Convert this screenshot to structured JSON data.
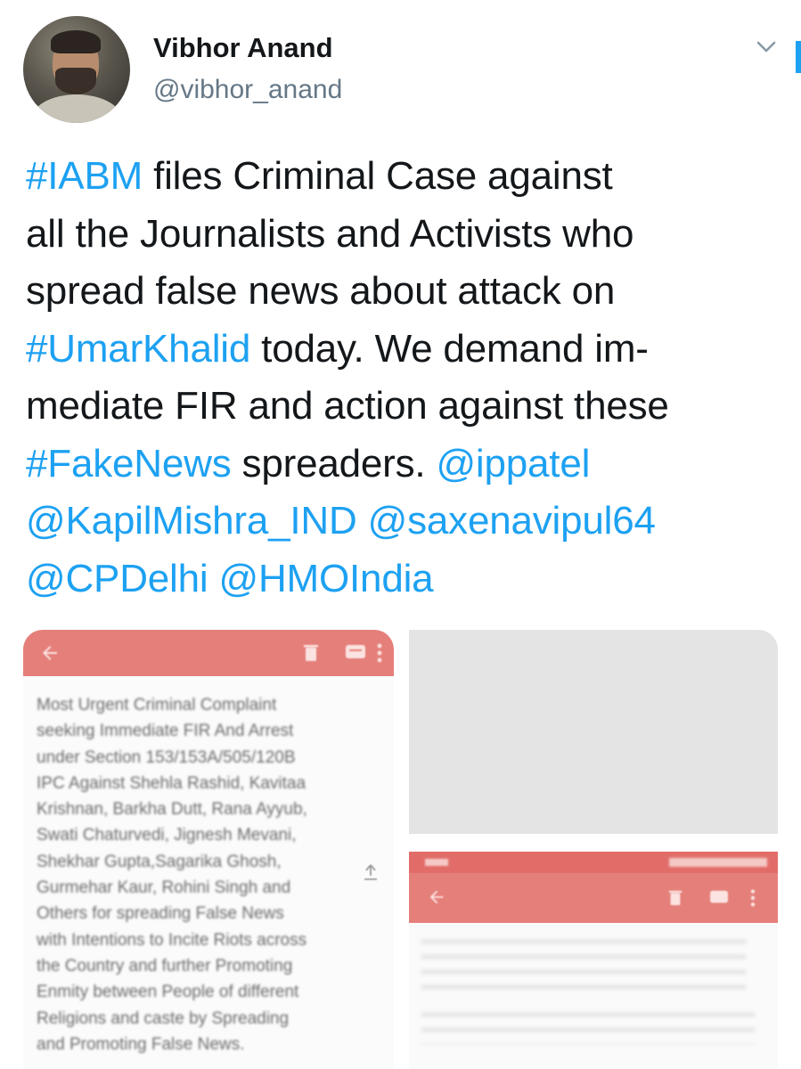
{
  "author": {
    "display_name": "Vibhor Anand",
    "handle": "@vibhor_anand"
  },
  "tweet": {
    "lines": [
      [
        {
          "text": "#IABM",
          "link": true
        },
        {
          "text": " files Criminal Case against",
          "link": false
        }
      ],
      [
        {
          "text": "all the Journalists and Activists who",
          "link": false
        }
      ],
      [
        {
          "text": "spread false news about attack on",
          "link": false
        }
      ],
      [
        {
          "text": "#UmarKhalid",
          "link": true
        },
        {
          "text": " today. We demand im-",
          "link": false
        }
      ],
      [
        {
          "text": "mediate FIR and action against these",
          "link": false
        }
      ],
      [
        {
          "text": "#FakeNews",
          "link": true
        },
        {
          "text": " spreaders. ",
          "link": false
        },
        {
          "text": "@ippatel",
          "link": true
        }
      ],
      [
        {
          "text": "@KapilMishra_IND",
          "link": true
        },
        {
          "text": " ",
          "link": false
        },
        {
          "text": "@saxenavipul64",
          "link": true
        }
      ],
      [
        {
          "text": "@CPDelhi",
          "link": true
        },
        {
          "text": " ",
          "link": false
        },
        {
          "text": "@HMOIndia",
          "link": true
        }
      ]
    ]
  },
  "media": {
    "left_document_lines": [
      "Most Urgent Criminal Complaint",
      "seeking Immediate FIR And Arrest",
      "under Section 153/153A/505/120B",
      "IPC Against Shehla Rashid, Kavitaa",
      "Krishnan, Barkha Dutt, Rana Ayyub,",
      "Swati Chaturvedi, Jignesh Mevani,",
      "Shekhar Gupta,Sagarika Ghosh,",
      "Gurmehar Kaur, Rohini Singh and",
      "Others for spreading False News",
      "with Intentions to Incite Riots across",
      "the Country and further Promoting",
      "Enmity between People of different",
      "Religions and caste by Spreading",
      "and Promoting False News."
    ]
  },
  "colors": {
    "link": "#1da1f2",
    "text": "#14171a",
    "handle": "#657786",
    "app_bar": "#e57f7a"
  },
  "icons": [
    "chevron-down-icon",
    "back-arrow-icon",
    "delete-icon",
    "message-icon",
    "more-vert-icon",
    "share-icon"
  ]
}
